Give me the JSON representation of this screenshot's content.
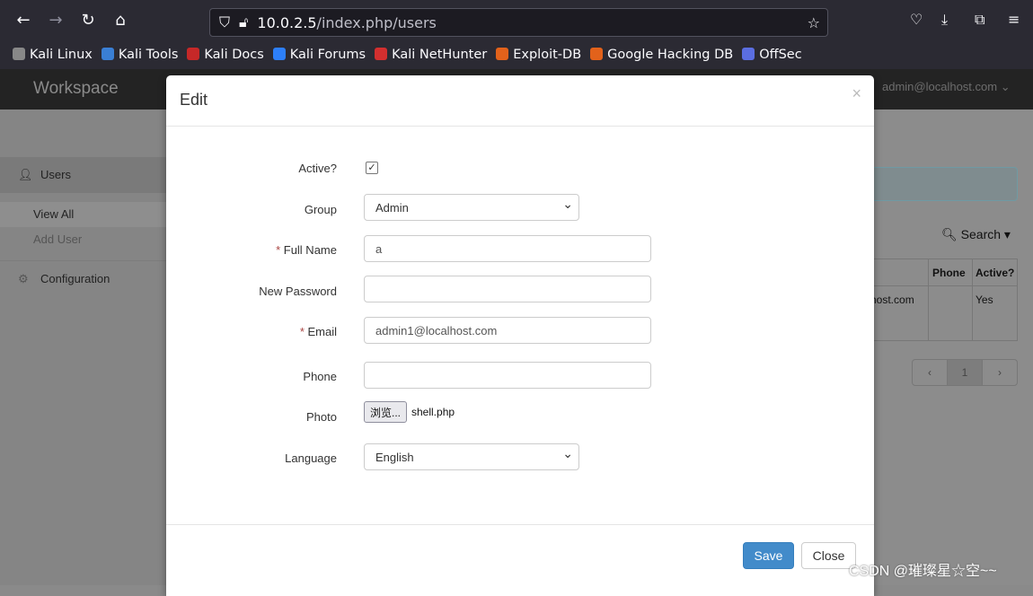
{
  "browser": {
    "url_host": "10.0.2.5",
    "url_path": "/index.php/users",
    "bookmarks": [
      {
        "label": "Kali Linux",
        "color": "#888"
      },
      {
        "label": "Kali Tools",
        "color": "#3a7fd5"
      },
      {
        "label": "Kali Docs",
        "color": "#c62828"
      },
      {
        "label": "Kali Forums",
        "color": "#2d7ff9"
      },
      {
        "label": "Kali NetHunter",
        "color": "#d32f2f"
      },
      {
        "label": "Exploit-DB",
        "color": "#e2621b"
      },
      {
        "label": "Google Hacking DB",
        "color": "#e2621b"
      },
      {
        "label": "OffSec",
        "color": "#5b6ee1"
      }
    ]
  },
  "app": {
    "brand": "Workspace",
    "user": "admin@localhost.com",
    "sidebar": {
      "users": "Users",
      "view_all": "View All",
      "add_user": "Add User",
      "configuration": "Configuration"
    },
    "search": "Search",
    "table": {
      "headers": [
        "Phone",
        "Active?"
      ],
      "cell_email": "host.com",
      "cell_active": "Yes"
    },
    "pager": {
      "prev": "‹",
      "page": "1",
      "next": "›"
    }
  },
  "modal": {
    "title": "Edit",
    "close_x": "×",
    "fields": {
      "active_label": "Active?",
      "active_checked": true,
      "group_label": "Group",
      "group_value": "Admin",
      "fullname_label": "Full Name",
      "fullname_value": "a",
      "password_label": "New Password",
      "password_value": "",
      "email_label": "Email",
      "email_value": "admin1@localhost.com",
      "phone_label": "Phone",
      "phone_value": "",
      "photo_label": "Photo",
      "browse_label": "浏览...",
      "photo_file": "shell.php",
      "language_label": "Language",
      "language_value": "English"
    },
    "save": "Save",
    "close": "Close",
    "save_color": "#428bca"
  },
  "watermark": "CSDN @璀璨星☆空~~"
}
